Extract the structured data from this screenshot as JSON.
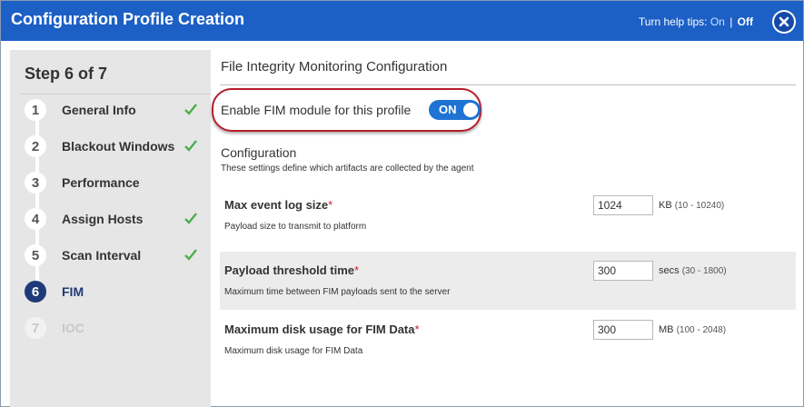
{
  "header": {
    "title": "Configuration Profile Creation",
    "help_prefix": "Turn help tips:",
    "help_on": "On",
    "help_separator": "|",
    "help_off": "Off"
  },
  "sidebar": {
    "heading": "Step 6 of 7",
    "steps": [
      {
        "num": "1",
        "label": "General Info",
        "done": true
      },
      {
        "num": "2",
        "label": "Blackout Windows",
        "done": true
      },
      {
        "num": "3",
        "label": "Performance",
        "done": false
      },
      {
        "num": "4",
        "label": "Assign Hosts",
        "done": true
      },
      {
        "num": "5",
        "label": "Scan Interval",
        "done": true
      },
      {
        "num": "6",
        "label": "FIM",
        "done": false,
        "active": true
      },
      {
        "num": "7",
        "label": "IOC",
        "done": false,
        "disabled": true
      }
    ]
  },
  "main": {
    "section_title": "File Integrity Monitoring Configuration",
    "fim_toggle_label": "Enable FIM module for this profile",
    "fim_toggle_state": "ON",
    "config_title": "Configuration",
    "config_desc": "These settings define which artifacts are collected by the agent",
    "settings": [
      {
        "name": "Max event log size",
        "required": "*",
        "desc": "Payload size to transmit to platform",
        "value": "1024",
        "unit": "KB",
        "range": "(10 - 10240)"
      },
      {
        "name": "Payload threshold time",
        "required": "*",
        "desc": "Maximum time between FIM payloads sent to the server",
        "value": "300",
        "unit": "secs",
        "range": "(30 - 1800)"
      },
      {
        "name": "Maximum disk usage for FIM Data",
        "required": "*",
        "desc": "Maximum disk usage for FIM Data",
        "value": "300",
        "unit": "MB",
        "range": "(100 - 2048)"
      }
    ]
  },
  "colors": {
    "header_bg": "#1c5fc5",
    "active_step": "#1f3a78",
    "toggle_on": "#1f73d2",
    "highlight_outline": "#b41e2a",
    "check": "#4cae4c"
  }
}
